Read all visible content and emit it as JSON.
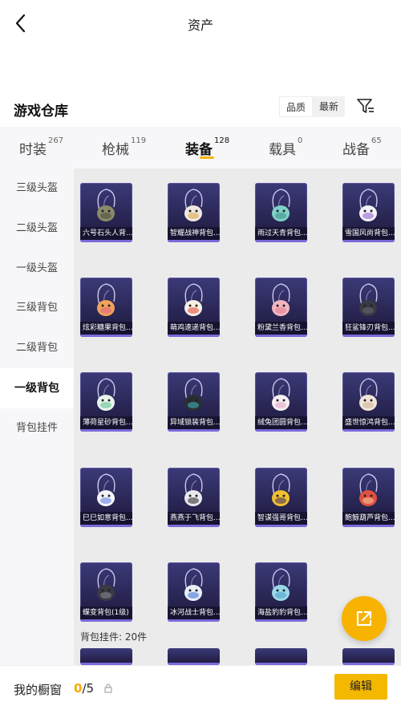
{
  "header": {
    "title": "资产"
  },
  "warehouse": {
    "title": "游戏仓库",
    "sort_options": [
      "品质",
      "最新"
    ],
    "active_sort": 0
  },
  "tabs": [
    {
      "label": "时装",
      "count": "267"
    },
    {
      "label": "枪械",
      "count": "119"
    },
    {
      "label": "装备",
      "count": "128"
    },
    {
      "label": "载具",
      "count": "0"
    },
    {
      "label": "战备",
      "count": "65"
    }
  ],
  "active_tab": 2,
  "sidebar": {
    "items": [
      {
        "label": "三级头盔"
      },
      {
        "label": "二级头盔"
      },
      {
        "label": "一级头盔"
      },
      {
        "label": "三级背包"
      },
      {
        "label": "二级背包"
      },
      {
        "label": "一级背包"
      },
      {
        "label": "背包挂件"
      }
    ],
    "active": 5
  },
  "items": [
    {
      "name": "六号石头人背...",
      "color": "#8a8a6a",
      "accent": "#4a4a3a"
    },
    {
      "name": "智耀战神背包...",
      "color": "#f0e8e0",
      "accent": "#d9a441"
    },
    {
      "name": "雨过天青背包...",
      "color": "#7fd0c8",
      "accent": "#3a8a88"
    },
    {
      "name": "雪国风尚背包...",
      "color": "#f4f2f8",
      "accent": "#8a5ad0"
    },
    {
      "name": "炫彩糖果背包...",
      "color": "#f0a25a",
      "accent": "#e0608a"
    },
    {
      "name": "萌鸡速递背包...",
      "color": "#f6f0e4",
      "accent": "#e04030"
    },
    {
      "name": "粉黛兰香背包...",
      "color": "#f2b6c0",
      "accent": "#e07a8a"
    },
    {
      "name": "狂鲨锋刃背包...",
      "color": "#3a3a44",
      "accent": "#6a6a78"
    },
    {
      "name": "薄荷星砂背包...",
      "color": "#e8f4ec",
      "accent": "#5ac08a"
    },
    {
      "name": "异域锁装背包...",
      "color": "#2c2e36",
      "accent": "#40c0c0"
    },
    {
      "name": "绒兔团圆背包...",
      "color": "#f6eef2",
      "accent": "#e0a0c0"
    },
    {
      "name": "盛世惊鸿背包...",
      "color": "#f0e4d8",
      "accent": "#d0b090"
    },
    {
      "name": "巳巳如意背包...",
      "color": "#f4f4fa",
      "accent": "#5a7ae0"
    },
    {
      "name": "燕燕于飞背包...",
      "color": "#e8e8ee",
      "accent": "#222"
    },
    {
      "name": "智谋强哥背包...",
      "color": "#f0c030",
      "accent": "#3a2a6a"
    },
    {
      "name": "鲍鲸葫芦背包...",
      "color": "#e05040",
      "accent": "#f0d0a0"
    },
    {
      "name": "蝶变背包(1级)",
      "color": "#3a3a44",
      "accent": "#8a8a9a"
    },
    {
      "name": "冰河战士背包...",
      "color": "#e8eef8",
      "accent": "#3a6ad0"
    },
    {
      "name": "海盐豹豹背包...",
      "color": "#9ad8e8",
      "accent": "#4a9ac8"
    }
  ],
  "pendant_header": "背包挂件: 20件",
  "bottom": {
    "label": "我的橱窗",
    "count_current": "0",
    "count_total": "/5",
    "edit_label": "编辑"
  },
  "colors": {
    "accent": "#f5b800",
    "card_bg": "#2a2756"
  },
  "icons": {
    "back": "back-arrow-icon",
    "filter": "filter-icon",
    "share": "share-external-icon",
    "lock": "lock-icon"
  }
}
